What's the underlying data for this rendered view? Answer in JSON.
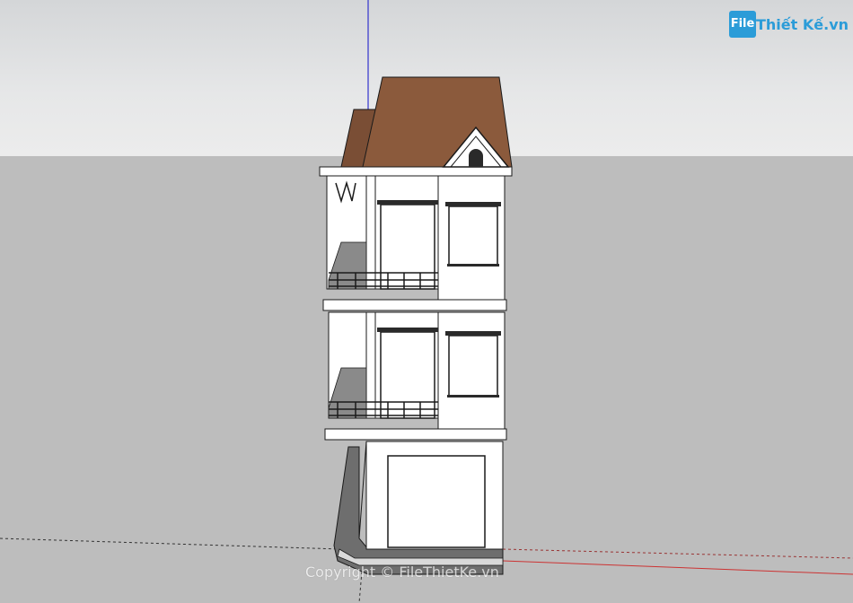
{
  "logo": {
    "badge": "File",
    "word": "Thiết Kế.vn"
  },
  "watermark": "Copyright © FileThietKe.vn",
  "colors": {
    "sky": "#e2e3e4",
    "ground": "#bdbdbd",
    "roof": "#8b5a3c",
    "wall": "#ffffff",
    "outline": "#1a1a1a",
    "accent_logo": "#2b9cd8",
    "axis_blue": "#3333cc",
    "axis_red": "#cc3333"
  }
}
